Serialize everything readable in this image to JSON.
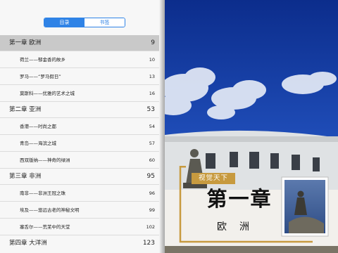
{
  "toc_panel": {
    "tabs": [
      {
        "label": "目录",
        "active": true
      },
      {
        "label": "书签",
        "active": false
      }
    ],
    "accent_color": "#2f83e6",
    "entries": [
      {
        "kind": "chapter",
        "title": "第一章  欧洲",
        "page": "9",
        "selected": true
      },
      {
        "kind": "sub",
        "title": "荷兰——郁金香的故乡",
        "page": "10"
      },
      {
        "kind": "sub",
        "title": "罗马——“罗马假日”",
        "page": "13"
      },
      {
        "kind": "sub",
        "title": "莫斯科——优雅的艺术之城",
        "page": "16"
      },
      {
        "kind": "chapter",
        "title": "第二章  亚洲",
        "page": "53"
      },
      {
        "kind": "sub",
        "title": "香港——时尚之都",
        "page": "54"
      },
      {
        "kind": "sub",
        "title": "青岛——海滨之城",
        "page": "57"
      },
      {
        "kind": "sub",
        "title": "西双版纳——神奇的绿洲",
        "page": "60"
      },
      {
        "kind": "chapter",
        "title": "第三章  非洲",
        "page": "95"
      },
      {
        "kind": "sub",
        "title": "南非——非洲王冠之珠",
        "page": "96"
      },
      {
        "kind": "sub",
        "title": "埃及——悠远古老的神秘文明",
        "page": "99"
      },
      {
        "kind": "sub",
        "title": "塞舌尔——荒芜中的天堂",
        "page": "102"
      },
      {
        "kind": "chapter",
        "title": "第四章  大洋洲",
        "page": "123"
      }
    ]
  },
  "book_page": {
    "tag": "视觉天下",
    "chapter_title": "第一章",
    "chapter_subtitle": "欧洲",
    "accent_color": "#c79a3f"
  }
}
